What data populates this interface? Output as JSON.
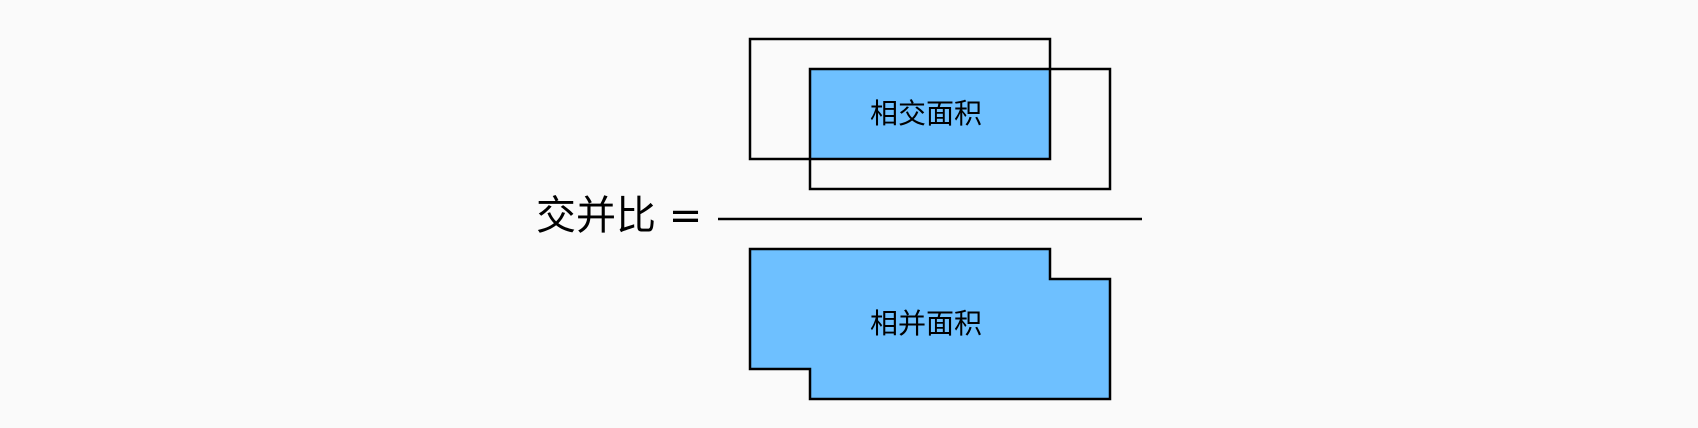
{
  "formula": {
    "lhs": "交并比 ="
  },
  "numerator": {
    "label": "相交面积"
  },
  "denominator": {
    "label": "相并面积"
  },
  "colors": {
    "fill": "#6ec0ff",
    "stroke": "#000000",
    "background": "#fafafa"
  }
}
